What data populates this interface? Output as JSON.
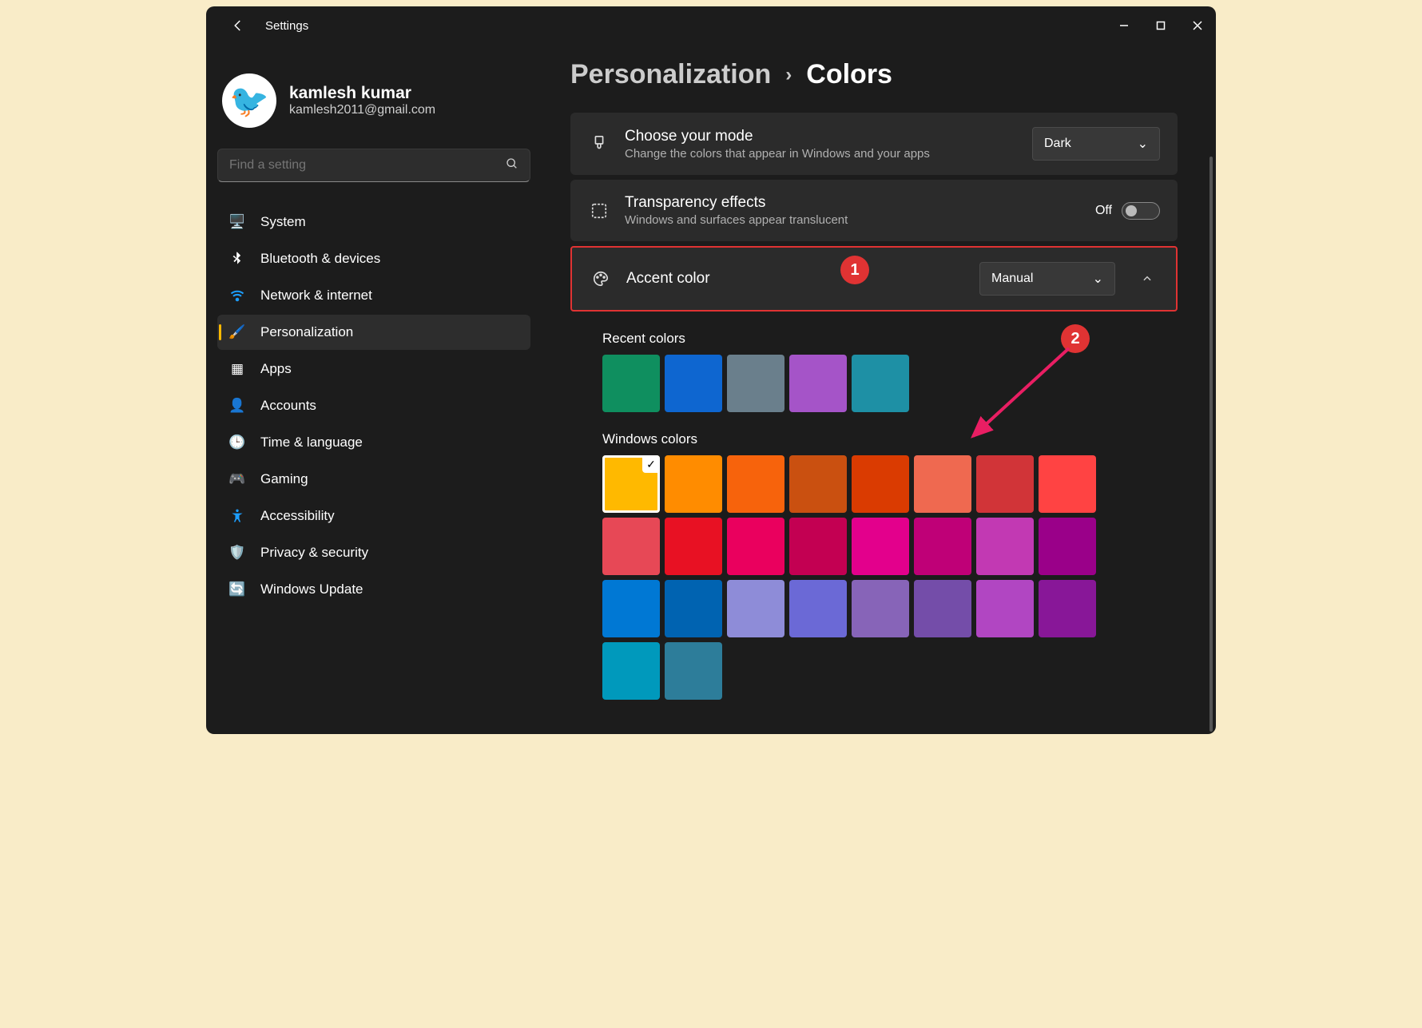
{
  "window": {
    "title": "Settings"
  },
  "profile": {
    "name": "kamlesh kumar",
    "email": "kamlesh2011@gmail.com",
    "avatar_emoji": "🐦"
  },
  "search": {
    "placeholder": "Find a setting"
  },
  "nav": [
    {
      "label": "System",
      "icon": "🖥️"
    },
    {
      "label": "Bluetooth & devices",
      "icon": "bt"
    },
    {
      "label": "Network & internet",
      "icon": "wifi"
    },
    {
      "label": "Personalization",
      "icon": "🖌️",
      "active": true
    },
    {
      "label": "Apps",
      "icon": "▦"
    },
    {
      "label": "Accounts",
      "icon": "👤"
    },
    {
      "label": "Time & language",
      "icon": "🕒"
    },
    {
      "label": "Gaming",
      "icon": "🎮"
    },
    {
      "label": "Accessibility",
      "icon": "acc"
    },
    {
      "label": "Privacy & security",
      "icon": "🛡️"
    },
    {
      "label": "Windows Update",
      "icon": "🔄"
    }
  ],
  "breadcrumb": {
    "parent": "Personalization",
    "current": "Colors"
  },
  "mode_card": {
    "title": "Choose your mode",
    "subtitle": "Change the colors that appear in Windows and your apps",
    "value": "Dark"
  },
  "transparency_card": {
    "title": "Transparency effects",
    "subtitle": "Windows and surfaces appear translucent",
    "state_label": "Off"
  },
  "accent_card": {
    "title": "Accent color",
    "value": "Manual"
  },
  "recent_colors_label": "Recent colors",
  "recent_colors": [
    "#0f8f5f",
    "#0e66d0",
    "#6a7f8c",
    "#a554c8",
    "#1e90a5"
  ],
  "windows_colors_label": "Windows colors",
  "windows_colors": [
    [
      "#ffb900",
      "#ff8c00",
      "#f7630c",
      "#ca5010",
      "#da3b01",
      "#ef6950",
      "#d13438",
      "#ff4343"
    ],
    [
      "#e74856",
      "#e81123",
      "#ea005e",
      "#c30052",
      "#e3008c",
      "#bf0077",
      "#c239b3",
      "#9a0089"
    ],
    [
      "#0078d4",
      "#0063b1",
      "#8e8cd8",
      "#6b69d6",
      "#8764b8",
      "#744da9",
      "#b146c2",
      "#881798"
    ],
    [
      "#0099bc",
      "#2d7d9a"
    ]
  ],
  "selected_color_index": [
    0,
    0
  ],
  "callouts": {
    "one": "1",
    "two": "2"
  }
}
